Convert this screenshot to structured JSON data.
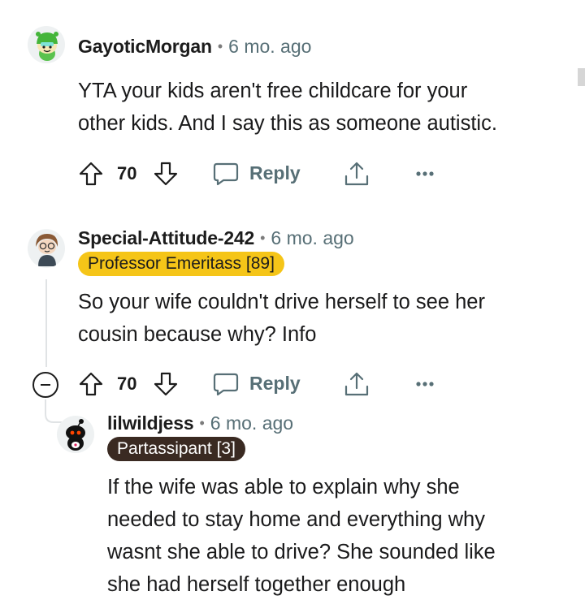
{
  "comments": [
    {
      "author": "GayoticMorgan",
      "separator": "•",
      "time": "6 mo. ago",
      "flair": null,
      "body_lines": [
        "YTA your kids aren't free childcare for your",
        "other kids. And I say this as someone autistic."
      ],
      "votes": "70",
      "reply_label": "Reply",
      "avatar_icon": "snoo-avatar-green-hat"
    },
    {
      "author": "Special-Attitude-242",
      "separator": "•",
      "time": "6 mo. ago",
      "flair": "Professor Emeritass [89]",
      "flair_bg": "#f5c518",
      "body_lines": [
        "So your wife couldn't drive herself to see her",
        "cousin because why? Info"
      ],
      "votes": "70",
      "reply_label": "Reply",
      "avatar_icon": "snoo-avatar-glasses"
    },
    {
      "author": "lilwildjess",
      "separator": "•",
      "time": "6 mo. ago",
      "flair": "Partassipant [3]",
      "flair_bg": "#3a2a22",
      "body_lines": [
        "If the wife was able to explain why she",
        "needed to stay home and everything why",
        "wasnt she able to drive? She sounded like",
        "she had herself together enough"
      ],
      "avatar_icon": "snoo-avatar-black"
    }
  ],
  "colors": {
    "meta_gray": "#576f76",
    "text": "#1a1a1b",
    "thread_line": "#e0e3e5"
  }
}
